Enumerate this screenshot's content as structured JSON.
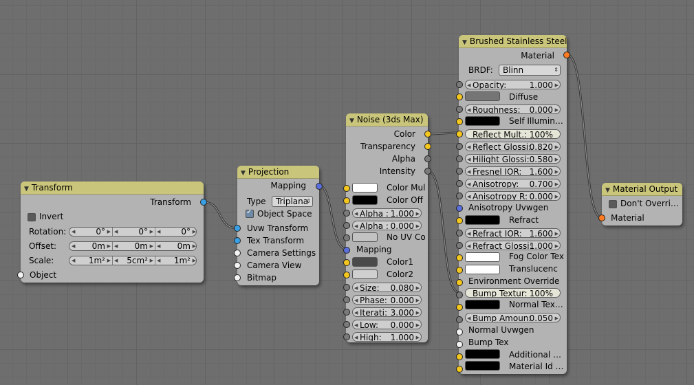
{
  "colors": {
    "socket_float": "#f5c71e",
    "socket_grey": "#7a7a7a",
    "socket_vector": "#5a6fdc",
    "socket_shader": "#ff7a20",
    "header": "#c9c57a"
  },
  "transform": {
    "title": "Transform",
    "out_transform": "Transform",
    "invert": "Invert",
    "rotation": {
      "label": "Rotation:",
      "x": "0°",
      "y": "0°",
      "z": "0°"
    },
    "offset": {
      "label": "Offset:",
      "x": "0m",
      "y": "0m",
      "z": "0m"
    },
    "scale": {
      "label": "Scale:",
      "x": "1m²",
      "y": "5cm²",
      "z": "1m²"
    },
    "in_object": "Object"
  },
  "projection": {
    "title": "Projection",
    "out_mapping": "Mapping",
    "type_label": "Type",
    "type_value": "Triplana",
    "object_space": "Object Space",
    "in_uvw": "Uvw Transform",
    "in_tex": "Tex Transform",
    "in_camera_settings": "Camera Settings",
    "in_camera_view": "Camera View",
    "in_bitmap": "Bitmap"
  },
  "noise": {
    "title": "Noise (3ds Max)",
    "out_color": "Color",
    "out_transparency": "Transparency",
    "out_alpha": "Alpha",
    "out_intensity": "Intensity",
    "color_mul": "Color Mul",
    "color_off": "Color Off",
    "alpha1": {
      "label": "Alpha :",
      "value": "1.000"
    },
    "alpha2": {
      "label": "Alpha :",
      "value": "0.000"
    },
    "no_uv": "No UV Co",
    "mapping": "Mapping",
    "color1": "Color1",
    "color2": "Color2",
    "size": {
      "label": "Size:",
      "value": "0.080"
    },
    "phase": {
      "label": "Phase:",
      "value": "0.000"
    },
    "iter": {
      "label": "Iterati:",
      "value": "3.000"
    },
    "low": {
      "label": "Low:",
      "value": "0.000"
    },
    "high": {
      "label": "High:",
      "value": "1.000"
    }
  },
  "steel": {
    "title": "Brushed Stainless Steel",
    "out_material": "Material",
    "brdf_label": "BRDF:",
    "brdf_value": "Blinn",
    "opacity": {
      "label": "Opacity:",
      "value": "1.000"
    },
    "diffuse": "Diffuse",
    "roughness": {
      "label": "Roughness:",
      "value": "0.000"
    },
    "self_illum": "Self Illumin…",
    "reflect_mult": {
      "label": "Reflect Mult.:",
      "value": "100%"
    },
    "reflect_gloss": {
      "label": "Reflect Glossi:",
      "value": "0.820"
    },
    "hilight_gloss": {
      "label": "Hilight Glossi:",
      "value": "0.580"
    },
    "fresnel": {
      "label": "Fresnel IOR:",
      "value": "1.600"
    },
    "aniso": {
      "label": "Anisotropy:",
      "value": "0.700"
    },
    "aniso_r": {
      "label": "Anisotropy R:",
      "value": "0.000"
    },
    "aniso_uvw": "Anisotropy Uvwgen",
    "refract": "Refract",
    "refract_ior": {
      "label": "Refract IOR:",
      "value": "1.600"
    },
    "refract_gloss": {
      "label": "Refract Glossi:",
      "value": "1.000"
    },
    "fog": "Fog Color Tex",
    "transl": "Translucenc",
    "env": "Environment Override",
    "bump_tex_f": {
      "label": "Bump Textur:",
      "value": "100%"
    },
    "normal_tex": "Normal Tex…",
    "bump_amount": {
      "label": "Bump Amoun:",
      "value": "0.050"
    },
    "normal_uvw": "Normal Uvwgen",
    "bump_tex": "Bump Tex",
    "additional": "Additional …",
    "material_id": "Material Id …"
  },
  "output": {
    "title": "Material Output",
    "dont_override": "Don't Overri…",
    "in_material": "Material"
  }
}
